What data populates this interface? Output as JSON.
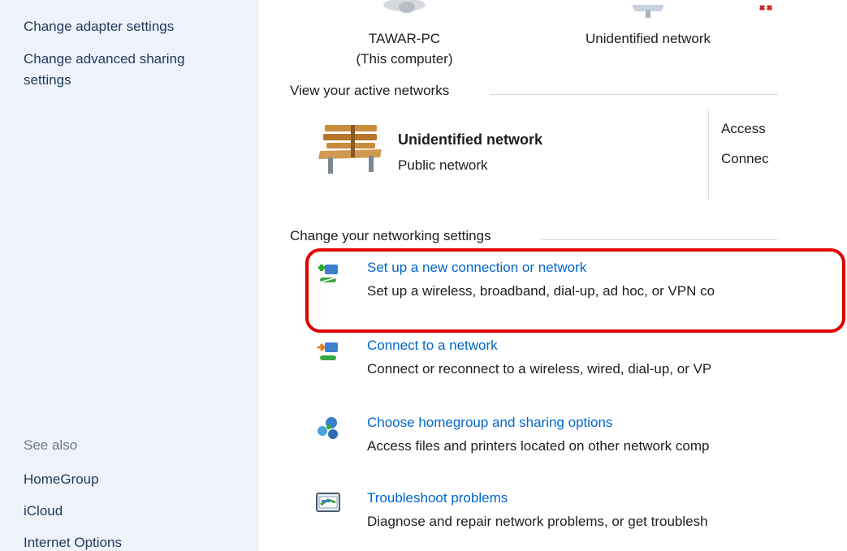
{
  "sidebar": {
    "links": [
      {
        "label": "Change adapter settings"
      },
      {
        "label": "Change advanced sharing"
      },
      {
        "label": "settings"
      }
    ],
    "see_also_heading": "See also",
    "see_also": [
      {
        "label": "HomeGroup"
      },
      {
        "label": "iCloud"
      },
      {
        "label": "Internet Options"
      }
    ]
  },
  "network_map": {
    "computer_name": "TAWAR-PC",
    "computer_note": "(This computer)",
    "network_label": "Unidentified network"
  },
  "active_networks": {
    "heading": "View your active networks",
    "network_name": "Unidentified network",
    "network_type": "Public network",
    "access_label": "Access",
    "connections_label": "Connec"
  },
  "change_settings": {
    "heading": "Change your networking settings",
    "tasks": [
      {
        "link": "Set up a new connection or network",
        "description": "Set up a wireless, broadband, dial-up, ad hoc, or VPN co",
        "icon": "new-connection-icon"
      },
      {
        "link": "Connect to a network",
        "description": "Connect or reconnect to a wireless, wired, dial-up, or VP",
        "icon": "connect-network-icon"
      },
      {
        "link": "Choose homegroup and sharing options",
        "description": "Access files and printers located on other network comp",
        "icon": "homegroup-icon"
      },
      {
        "link": "Troubleshoot problems",
        "description": "Diagnose and repair network problems, or get troublesh",
        "icon": "troubleshoot-icon"
      }
    ]
  },
  "colors": {
    "link": "#0066cc",
    "sidebar_bg": "#eef3fa",
    "highlight": "#e00000"
  }
}
